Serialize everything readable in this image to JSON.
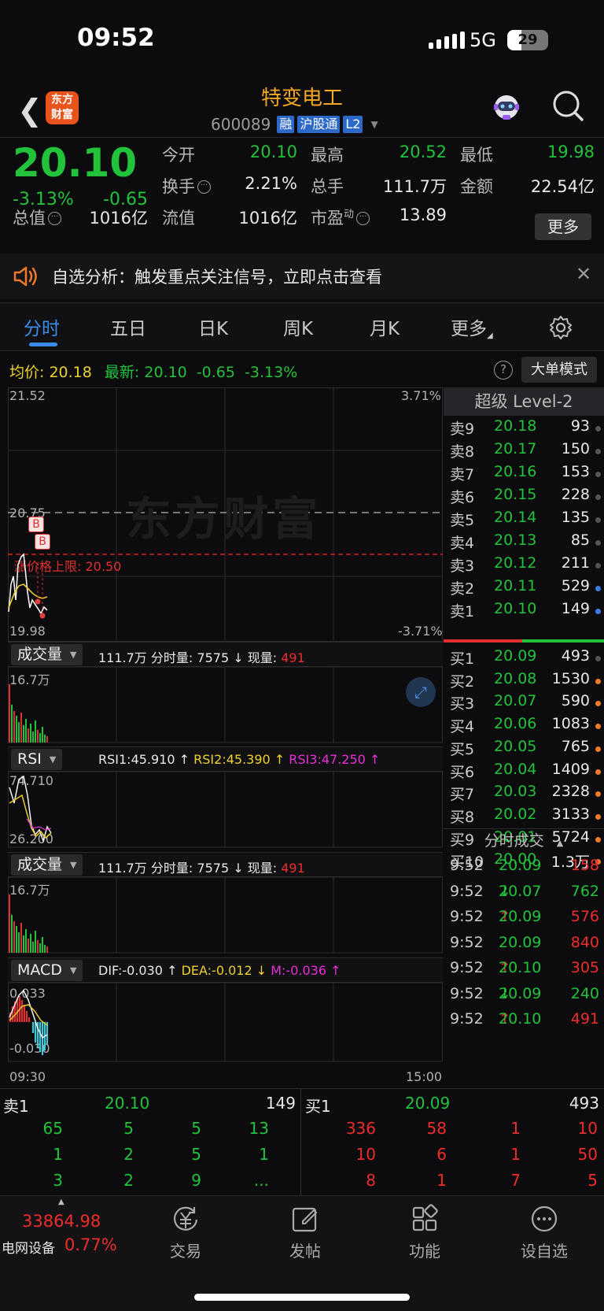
{
  "status": {
    "time": "09:52",
    "network": "5G",
    "battery": "29"
  },
  "header": {
    "back_icon": "back-chevron-icon",
    "logo_text": "东方财富",
    "name": "特变电工",
    "code": "600089",
    "tags": [
      "融",
      "沪股通",
      "L2"
    ]
  },
  "quote": {
    "price": "20.10",
    "change_pct": "-3.13%",
    "change": "-0.65",
    "labels": {
      "open": "今开",
      "high": "最高",
      "low": "最低",
      "turnover": "换手",
      "volume": "总手",
      "amount": "金额",
      "total_cap": "总值",
      "float_cap": "流值",
      "pe": "市盈",
      "pe_sup": "动"
    },
    "values": {
      "open": "20.10",
      "high": "20.52",
      "low": "19.98",
      "turnover": "2.21%",
      "volume": "111.7万",
      "amount": "22.54亿",
      "total_cap": "1016亿",
      "float_cap": "1016亿",
      "pe": "13.89"
    },
    "more": "更多"
  },
  "notice": {
    "text": "自选分析：触发重点关注信号，立即点击查看"
  },
  "tabs": [
    "分时",
    "五日",
    "日K",
    "周K",
    "月K",
    "更多"
  ],
  "infobar": {
    "avg_label": "均价:",
    "avg": "20.18",
    "latest_label": "最新:",
    "latest": "20.10",
    "change": "-0.65",
    "pct": "-3.13%",
    "big_order": "大单模式"
  },
  "chart": {
    "top_price": "21.52",
    "top_pct": "3.71%",
    "mid_price": "20.75",
    "limit_label": "涨价格上限:",
    "limit_value": "20.50",
    "bottom_price": "19.98",
    "bottom_pct": "-3.71%",
    "watermark": "东方财富",
    "badges": [
      "B",
      "B"
    ],
    "volume_panel": {
      "name": "成交量",
      "total": "111.7万",
      "split_label": "分时量:",
      "split": "7575",
      "now_label": "现量:",
      "now": "491",
      "axis_top": "16.7万"
    },
    "rsi_panel": {
      "name": "RSI",
      "rsi1": "RSI1:45.910",
      "rsi2": "RSI2:45.390",
      "rsi3": "RSI3:47.250",
      "axis_top": "74.710",
      "axis_bottom": "26.200"
    },
    "volume2_panel": {
      "name": "成交量",
      "total": "111.7万",
      "split_label": "分时量:",
      "split": "7575",
      "now_label": "现量:",
      "now": "491",
      "axis_top": "16.7万"
    },
    "macd_panel": {
      "name": "MACD",
      "dif": "DIF:-0.030",
      "dea": "DEA:-0.012",
      "m": "M:-0.036",
      "axis_top": "0.033",
      "axis_bottom": "-0.030"
    },
    "time_start": "09:30",
    "time_end": "15:00"
  },
  "orderbook": {
    "title": "超级 Level-2",
    "asks": [
      {
        "label": "卖9",
        "price": "20.18",
        "vol": "93"
      },
      {
        "label": "卖8",
        "price": "20.17",
        "vol": "150"
      },
      {
        "label": "卖7",
        "price": "20.16",
        "vol": "153"
      },
      {
        "label": "卖6",
        "price": "20.15",
        "vol": "228"
      },
      {
        "label": "卖5",
        "price": "20.14",
        "vol": "135"
      },
      {
        "label": "卖4",
        "price": "20.13",
        "vol": "85"
      },
      {
        "label": "卖3",
        "price": "20.12",
        "vol": "211"
      },
      {
        "label": "卖2",
        "price": "20.11",
        "vol": "529"
      },
      {
        "label": "卖1",
        "price": "20.10",
        "vol": "149"
      }
    ],
    "bids": [
      {
        "label": "买1",
        "price": "20.09",
        "vol": "493"
      },
      {
        "label": "买2",
        "price": "20.08",
        "vol": "1530"
      },
      {
        "label": "买3",
        "price": "20.07",
        "vol": "590"
      },
      {
        "label": "买4",
        "price": "20.06",
        "vol": "1083"
      },
      {
        "label": "买5",
        "price": "20.05",
        "vol": "765"
      },
      {
        "label": "买6",
        "price": "20.04",
        "vol": "1409"
      },
      {
        "label": "买7",
        "price": "20.03",
        "vol": "2328"
      },
      {
        "label": "买8",
        "price": "20.02",
        "vol": "3133"
      },
      {
        "label": "买9",
        "price": "20.01",
        "vol": "5724"
      },
      {
        "label": "买10",
        "price": "20.00",
        "vol": "1.3万"
      }
    ],
    "trades_title": "分时成交",
    "trades": [
      {
        "time": "9:52",
        "price": "20.09",
        "arrow": "",
        "vol": "158"
      },
      {
        "time": "9:52",
        "price": "20.07",
        "arrow": "↓",
        "vol": "762"
      },
      {
        "time": "9:52",
        "price": "20.09",
        "arrow": "↑",
        "vol": "576"
      },
      {
        "time": "9:52",
        "price": "20.09",
        "arrow": "",
        "vol": "840"
      },
      {
        "time": "9:52",
        "price": "20.10",
        "arrow": "↑",
        "vol": "305"
      },
      {
        "time": "9:52",
        "price": "20.09",
        "arrow": "↓",
        "vol": "240"
      },
      {
        "time": "9:52",
        "price": "20.10",
        "arrow": "↑",
        "vol": "491"
      }
    ]
  },
  "book": {
    "ask_label": "卖1",
    "ask_price": "20.10",
    "ask_vol": "149",
    "bid_label": "买1",
    "bid_price": "20.09",
    "bid_vol": "493",
    "ask_rows": [
      [
        "65",
        "5",
        "5",
        "13"
      ],
      [
        "1",
        "2",
        "5",
        "1"
      ],
      [
        "3",
        "2",
        "9",
        "..."
      ]
    ],
    "bid_rows": [
      [
        "336",
        "58",
        "1",
        "10"
      ],
      [
        "10",
        "6",
        "1",
        "50"
      ],
      [
        "8",
        "1",
        "7",
        "5"
      ]
    ]
  },
  "bottom": {
    "index_value": "33864.98",
    "index_name": "电网设备",
    "index_pct": "0.77%",
    "nav": [
      "交易",
      "发帖",
      "功能",
      "设自选"
    ]
  }
}
